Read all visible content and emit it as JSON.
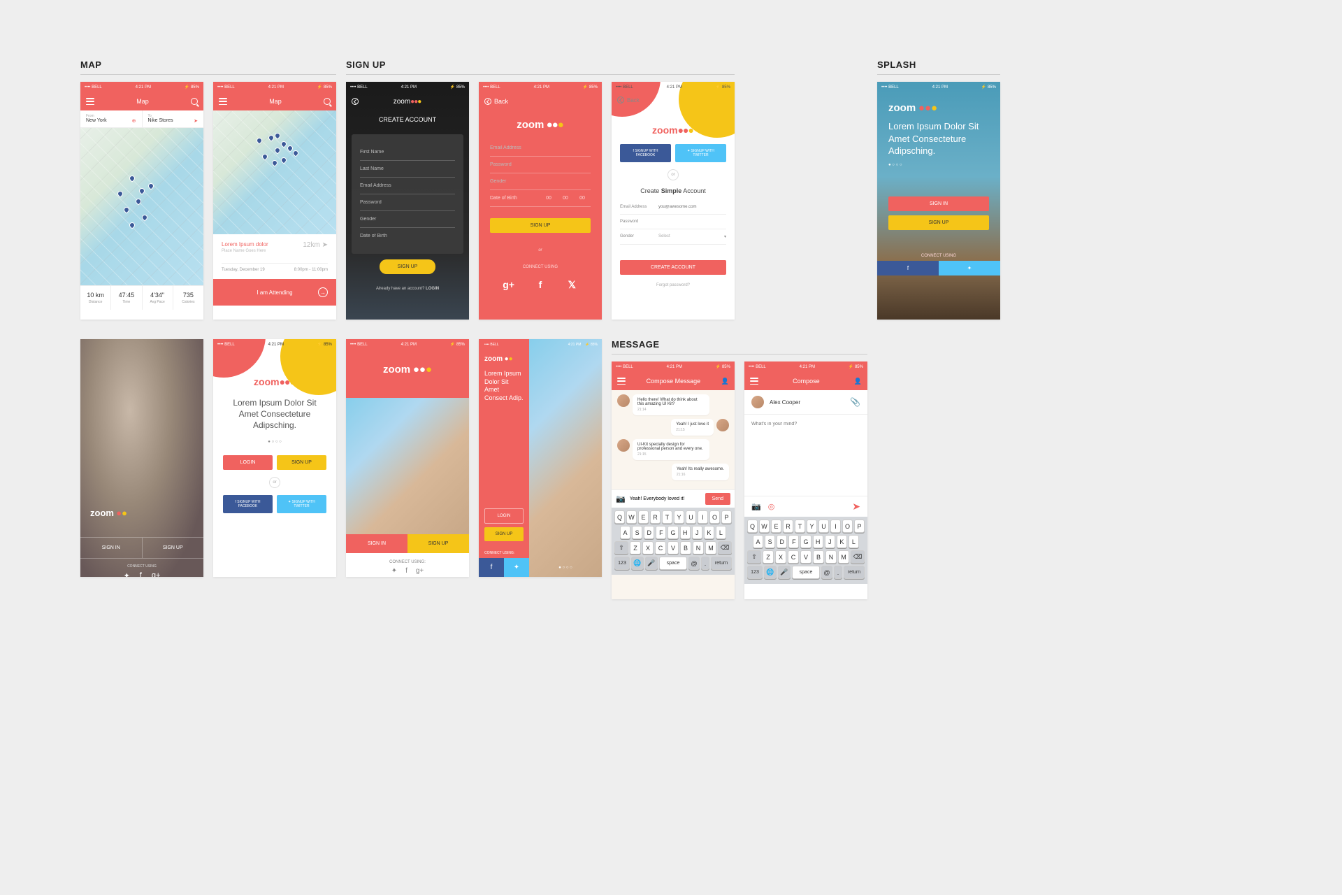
{
  "sections": {
    "map": "MAP",
    "signup": "SIGN UP",
    "splash": "SPLASH",
    "message": "MESSAGE"
  },
  "status": {
    "carrier": "•••• BELL",
    "time": "4:21 PM",
    "battery": "85%"
  },
  "brand": "zoom",
  "map1": {
    "title": "Map",
    "from_label": "From",
    "from_val": "New York",
    "to_label": "To",
    "to_val": "Nike Stores",
    "stats": [
      {
        "v": "10 km",
        "l": "Distance"
      },
      {
        "v": "47:45",
        "l": "Time"
      },
      {
        "v": "4'34\"",
        "l": "Avg Pace"
      },
      {
        "v": "735",
        "l": "Calories"
      }
    ]
  },
  "map2": {
    "title": "Map",
    "card_title": "Lorem Ipsum dolor",
    "card_sub": "Place Name Goes Here",
    "card_dist": "12km",
    "card_date": "Tuesday, December 19",
    "card_time": "8:00pm - 11:00pm",
    "attend": "I am Attending"
  },
  "su1": {
    "title": "CREATE ACCOUNT",
    "fields": [
      "First Name",
      "Last Name",
      "Email Address",
      "Password",
      "Gender",
      "Date of Birth"
    ],
    "btn": "SIGN UP",
    "footer": "Already have an account? ",
    "login": "LOGIN"
  },
  "su2": {
    "back": "Back",
    "fields": [
      "Email Address",
      "Password",
      "Gender"
    ],
    "dob": "Date of Birth",
    "dob_vals": [
      "00",
      "00",
      "00"
    ],
    "btn": "SIGN UP",
    "or": "or",
    "connect": "CONNECT USING"
  },
  "su3": {
    "back": "Back",
    "title_pre": "Create ",
    "title_bold": "Simple",
    "title_post": " Account",
    "rows": [
      {
        "l": "Email Address",
        "p": "you@awesome.com"
      },
      {
        "l": "Password",
        "p": ""
      },
      {
        "l": "Gender",
        "p": "Select"
      }
    ],
    "fb": "SIGNUP WITH FACEBOOK",
    "tw": "SIGNUP WITH TWITTER",
    "or": "or",
    "create": "CREATE ACCOUNT",
    "forgot": "Forgot password?"
  },
  "splash": {
    "headline": "Lorem Ipsum Dolor Sit Amet Consecteture Adipsching.",
    "signin": "SIGN IN",
    "signup": "SIGN UP",
    "connect": "CONNECT USING"
  },
  "sp1": {
    "signin": "SIGN IN",
    "signup": "SIGN UP",
    "connect": "CONNECT USING"
  },
  "sp2": {
    "headline": "Lorem Ipsum Dolor Sit Amet Consecteture Adipsching.",
    "login": "LOGIN",
    "signup": "SIGN UP",
    "or": "or",
    "fb": "SIGNUP WITH FACEBOOK",
    "tw": "SIGNUP WITH TWITTER"
  },
  "sp3": {
    "signin": "SIGN IN",
    "signup": "SIGN UP",
    "connect": "CONNECT USING:"
  },
  "sp4": {
    "headline": "Lorem Ipsum Dolor Sit Amet Consect Adip.",
    "login": "LOGIN",
    "signup": "SIGN UP",
    "connect": "CONNECT USING:"
  },
  "msg1": {
    "title": "Compose Message",
    "m1": "Hello there! What do think about this amazing UI Kit?",
    "t1": "21:14",
    "m2": "Yeah! I just love it",
    "t2": "21:15",
    "m3": "UI-Kit specially design for professional person and every one.",
    "t3": "21:15",
    "m4": "Yeah! Its really awesome.",
    "t4": "21:16",
    "input": "Yeah! Everybody loved it!",
    "send": "Send"
  },
  "msg2": {
    "title": "Compose",
    "name": "Alex Cooper",
    "placeholder": "What's in your mind?"
  },
  "keys": {
    "r1": [
      "Q",
      "W",
      "E",
      "R",
      "T",
      "Y",
      "U",
      "I",
      "O",
      "P"
    ],
    "r2": [
      "A",
      "S",
      "D",
      "F",
      "G",
      "H",
      "J",
      "K",
      "L"
    ],
    "r3": [
      "Z",
      "X",
      "C",
      "V",
      "B",
      "N",
      "M"
    ],
    "num": "123",
    "space": "space",
    "ret": "return"
  }
}
